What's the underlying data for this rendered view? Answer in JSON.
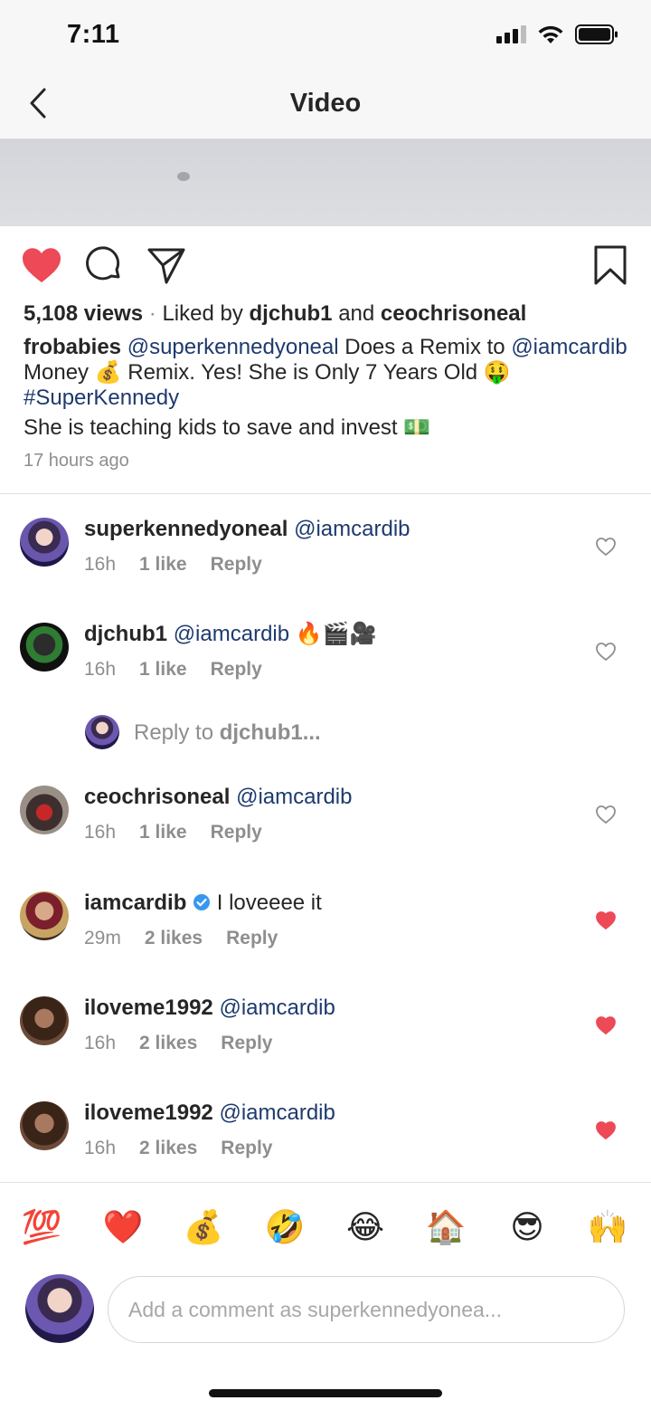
{
  "status": {
    "time": "7:11",
    "icons": [
      "cellular-signal-icon",
      "wifi-icon",
      "battery-icon"
    ]
  },
  "nav": {
    "title": "Video",
    "back_icon": "chevron-left-icon"
  },
  "post": {
    "actions": [
      "heart-icon",
      "comment-icon",
      "share-icon",
      "bookmark-icon"
    ],
    "liked": true,
    "views": "5,108 views",
    "separator": "·",
    "liked_by_prefix": "Liked by",
    "liked_by_user1": "djchub1",
    "liked_by_and": "and",
    "liked_by_user2": "ceochrisoneal",
    "caption_user": "frobabies",
    "caption_mention1": "@superkennedyoneal",
    "caption_text1": "Does a Remix to",
    "caption_mention2": "@iamcardib",
    "caption_text2": "Money 💰 Remix. Yes! She is Only 7 Years Old",
    "caption_emoji": "🤑",
    "caption_hashtag": "#SuperKennedy",
    "caption_line2": "She is teaching kids to save and invest 💵",
    "time_ago": "17 hours ago"
  },
  "comments": [
    {
      "username": "superkennedyoneal",
      "verified": false,
      "mention": "@iamcardib",
      "text": "",
      "time": "16h",
      "likes": "1 like",
      "reply": "Reply",
      "liked": false
    },
    {
      "username": "djchub1",
      "verified": false,
      "mention": "@iamcardib",
      "text": "🔥🎬🎥",
      "time": "16h",
      "likes": "1 like",
      "reply": "Reply",
      "liked": false
    },
    {
      "username": "ceochrisoneal",
      "verified": false,
      "mention": "@iamcardib",
      "text": "",
      "time": "16h",
      "likes": "1 like",
      "reply": "Reply",
      "liked": false
    },
    {
      "username": "iamcardib",
      "verified": true,
      "mention": "",
      "text": "I loveeee it",
      "time": "29m",
      "likes": "2 likes",
      "reply": "Reply",
      "liked": true
    },
    {
      "username": "iloveme1992",
      "verified": false,
      "mention": "@iamcardib",
      "text": "",
      "time": "16h",
      "likes": "2 likes",
      "reply": "Reply",
      "liked": true
    },
    {
      "username": "iloveme1992",
      "verified": false,
      "mention": "@iamcardib",
      "text": "",
      "time": "16h",
      "likes": "2 likes",
      "reply": "Reply",
      "liked": true
    }
  ],
  "reply_to": {
    "prefix": "Reply to",
    "user": "djchub1..."
  },
  "emoji_bar": [
    "💯",
    "❤️",
    "💰",
    "🤣",
    "😂",
    "🏠",
    "😎",
    "🙌"
  ],
  "compose": {
    "placeholder": "Add a comment as superkennedyonea..."
  },
  "colors": {
    "like_red": "#ed4956",
    "link_blue": "#1e3a6e",
    "verified_blue": "#3897f0",
    "meta_gray": "#8e8e8e"
  }
}
